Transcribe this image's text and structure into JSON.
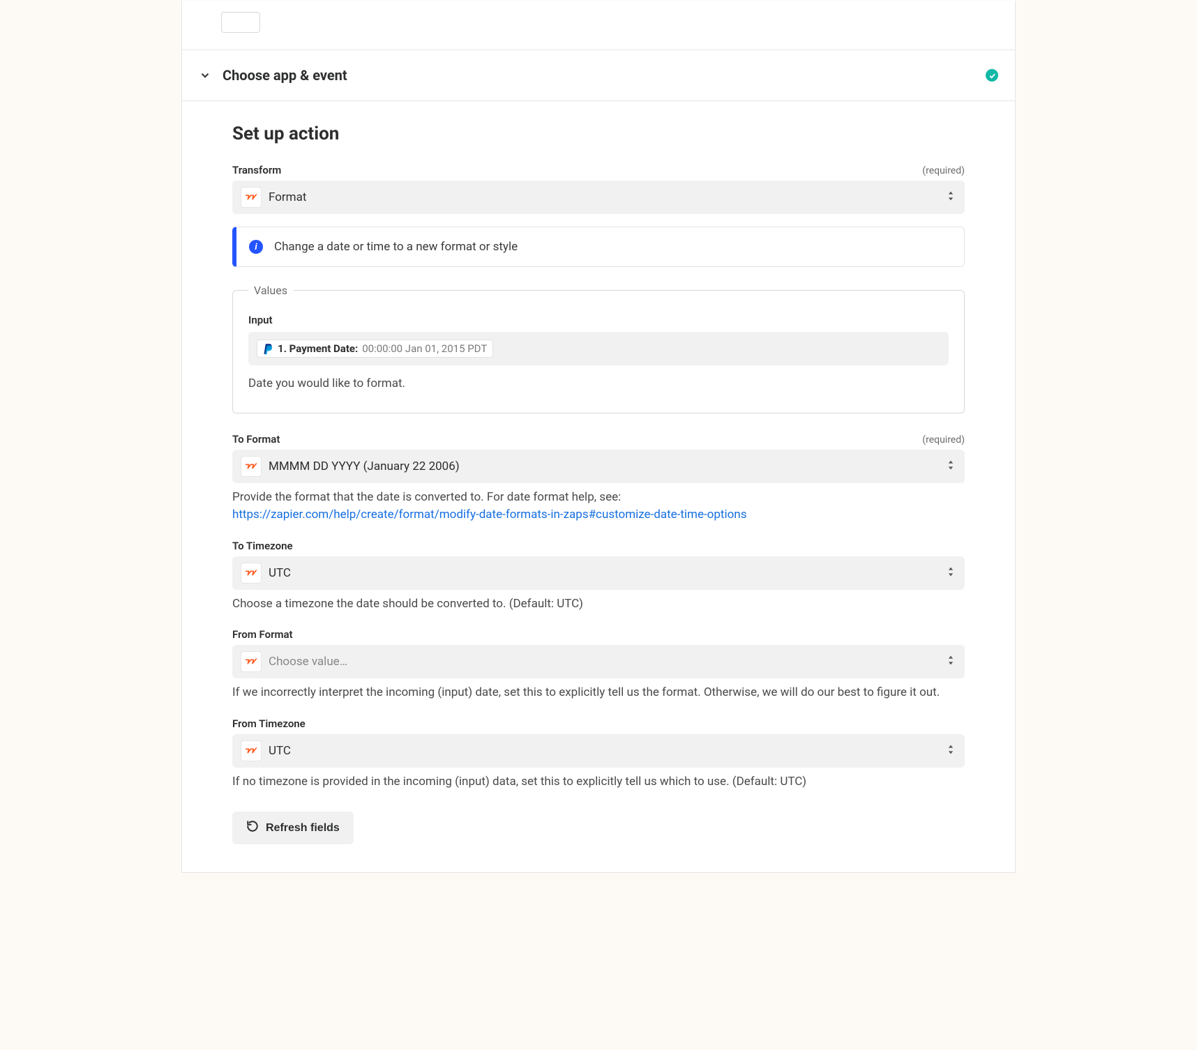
{
  "section_header": {
    "title": "Choose app & event"
  },
  "setup": {
    "title": "Set up action",
    "transform": {
      "label": "Transform",
      "required": "(required)",
      "value": "Format"
    },
    "info": {
      "text": "Change a date or time to a new format or style"
    },
    "values": {
      "legend": "Values",
      "input_label": "Input",
      "pill_prefix": "1. Payment Date:",
      "pill_value": "00:00:00 Jan 01, 2015 PDT",
      "helper": "Date you would like to format."
    },
    "to_format": {
      "label": "To Format",
      "required": "(required)",
      "value": "MMMM DD YYYY (January 22 2006)",
      "helper_prefix": "Provide the format that the date is converted to. For date format help, see:",
      "helper_link": "https://zapier.com/help/create/format/modify-date-formats-in-zaps#customize-date-time-options"
    },
    "to_timezone": {
      "label": "To Timezone",
      "value": "UTC",
      "helper": "Choose a timezone the date should be converted to. (Default: UTC)"
    },
    "from_format": {
      "label": "From Format",
      "placeholder": "Choose value…",
      "helper": "If we incorrectly interpret the incoming (input) date, set this to explicitly tell us the format. Otherwise, we will do our best to figure it out."
    },
    "from_timezone": {
      "label": "From Timezone",
      "value": "UTC",
      "helper": "If no timezone is provided in the incoming (input) data, set this to explicitly tell us which to use. (Default: UTC)"
    },
    "refresh_label": "Refresh fields"
  }
}
